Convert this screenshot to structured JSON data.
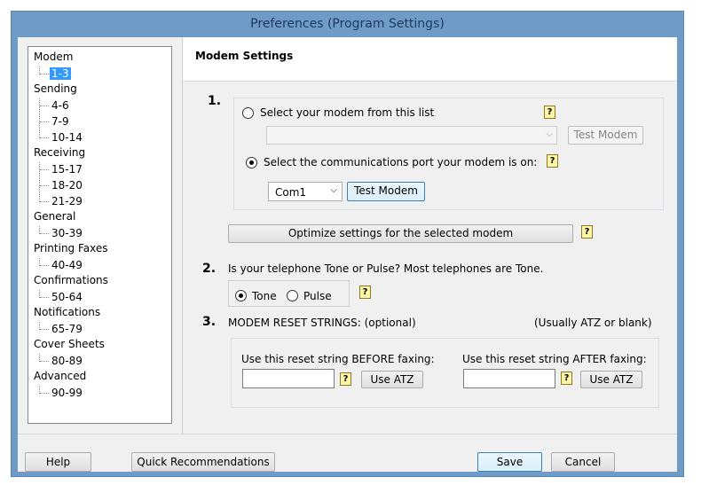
{
  "window": {
    "title": "Preferences (Program Settings)"
  },
  "tree": {
    "groups": [
      {
        "label": "Modem",
        "items": [
          "1-3"
        ]
      },
      {
        "label": "Sending",
        "items": [
          "4-6",
          "7-9",
          "10-14"
        ]
      },
      {
        "label": "Receiving",
        "items": [
          "15-17",
          "18-20",
          "21-29"
        ]
      },
      {
        "label": "General",
        "items": [
          "30-39"
        ]
      },
      {
        "label": "Printing Faxes",
        "items": [
          "40-49"
        ]
      },
      {
        "label": "Confirmations",
        "items": [
          "50-64"
        ]
      },
      {
        "label": "Notifications",
        "items": [
          "65-79"
        ]
      },
      {
        "label": "Cover Sheets",
        "items": [
          "80-89"
        ]
      },
      {
        "label": "Advanced",
        "items": [
          "90-99"
        ]
      }
    ],
    "selected": "1-3"
  },
  "panel": {
    "title": "Modem Settings",
    "section1": {
      "number": "1.",
      "option_list": "Select your modem from this list",
      "modem_list_value": "",
      "test_modem_disabled": "Test Modem",
      "option_port": "Select the communications port your modem is on:",
      "port_value": "Com1",
      "test_modem": "Test Modem",
      "optimize": "Optimize settings for the selected modem"
    },
    "section2": {
      "number": "2.",
      "question": "Is your telephone Tone or Pulse? Most telephones are Tone.",
      "tone": "Tone",
      "pulse": "Pulse"
    },
    "section3": {
      "number": "3.",
      "title": "MODEM RESET STRINGS: (optional)",
      "hint": "(Usually ATZ or blank)",
      "before_label": "Use this reset string BEFORE  faxing:",
      "before_value": "",
      "after_label": "Use this reset string AFTER faxing:",
      "after_value": "",
      "use_atz": "Use ATZ"
    }
  },
  "footer": {
    "help": "Help",
    "recommendations": "Quick Recommendations",
    "save": "Save",
    "cancel": "Cancel"
  },
  "icons": {
    "help": "help-balloon-icon",
    "dropdown": "chevron-down-icon"
  },
  "colors": {
    "titlebar": "#6f9bc7",
    "selection": "#3399ff"
  }
}
